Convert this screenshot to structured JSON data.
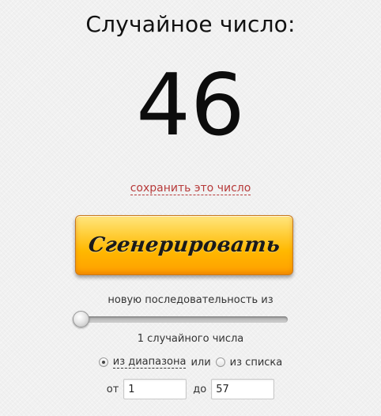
{
  "heading": "Случайное число:",
  "result": "46",
  "save_link": "сохранить это число",
  "generate_button": "Сгенерировать",
  "sequence_label": "новую последовательность из",
  "count": {
    "value": 1,
    "label": "1 случайного числа"
  },
  "mode": {
    "range_option": "из диапазона",
    "or_text": "или",
    "list_option": "из списка",
    "selected": "range"
  },
  "range": {
    "from_label": "от",
    "from_value": "1",
    "to_label": "до",
    "to_value": "57"
  },
  "colors": {
    "link": "#b73a3a",
    "button_top": "#ffe680",
    "button_bottom": "#ff9e00"
  }
}
